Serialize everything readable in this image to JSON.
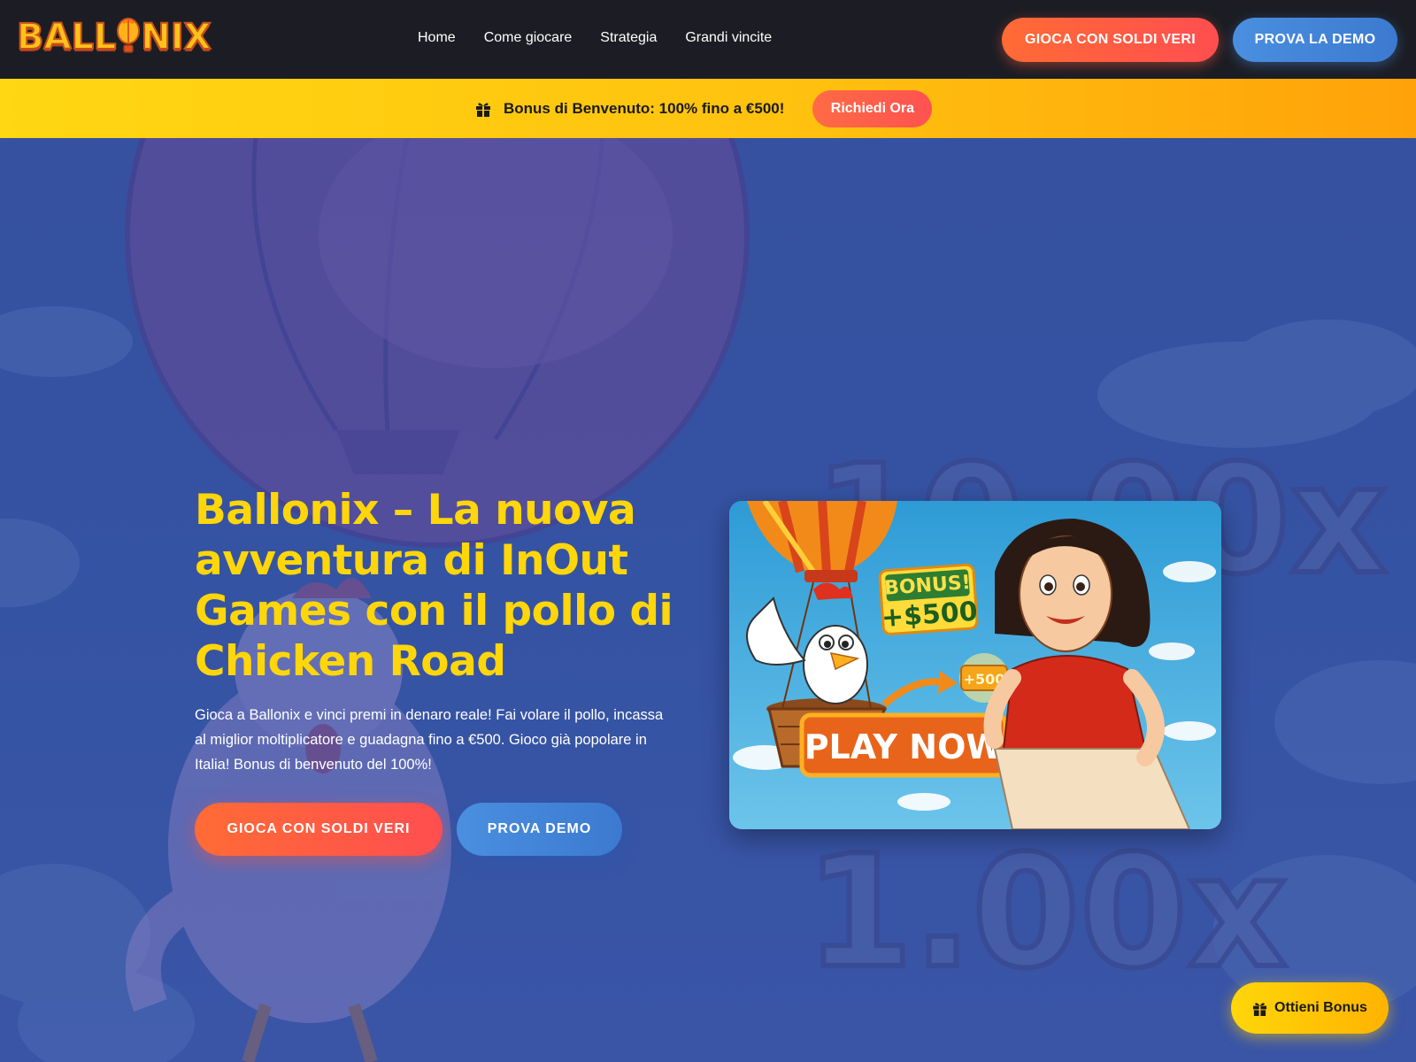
{
  "brand": {
    "logo_text": "BALLONIX"
  },
  "nav": {
    "links": [
      "Home",
      "Come giocare",
      "Strategia",
      "Grandi vincite"
    ],
    "play_real_label": "GIOCA CON SOLDI VERI",
    "demo_label": "PROVA LA DEMO"
  },
  "bonus_bar": {
    "icon": "gift-icon",
    "text": "Bonus di Benvenuto: 100% fino a €500!",
    "cta_label": "Richiedi Ora"
  },
  "hero": {
    "title": "Ballonix – La nuova avventura di InOut Games con il pollo di Chicken Road",
    "description": "Gioca a Ballonix e vinci premi in denaro reale! Fai volare il pollo, incassa al miglior moltiplicatore e guadagna fino a €500. Gioco già popolare in Italia! Bonus di benvenuto del 100%!",
    "play_real_label": "GIOCA CON SOLDI VERI",
    "demo_label": "PROVA DEMO",
    "background_multipliers": [
      "10.00x",
      "1.00x"
    ]
  },
  "promo_image": {
    "badge_line1": "BONUS!",
    "badge_line2": "+$500",
    "coin_label": "+500",
    "cta": "PLAY NOW"
  },
  "floating_button": {
    "icon": "gift-icon",
    "label": "Ottieni Bonus"
  },
  "colors": {
    "navbar_bg": "#1c1d24",
    "accent_orange": "#ff5a3c",
    "accent_blue": "#4a8fe0",
    "accent_yellow": "#ffd60a",
    "hero_bg": "#33509e"
  }
}
